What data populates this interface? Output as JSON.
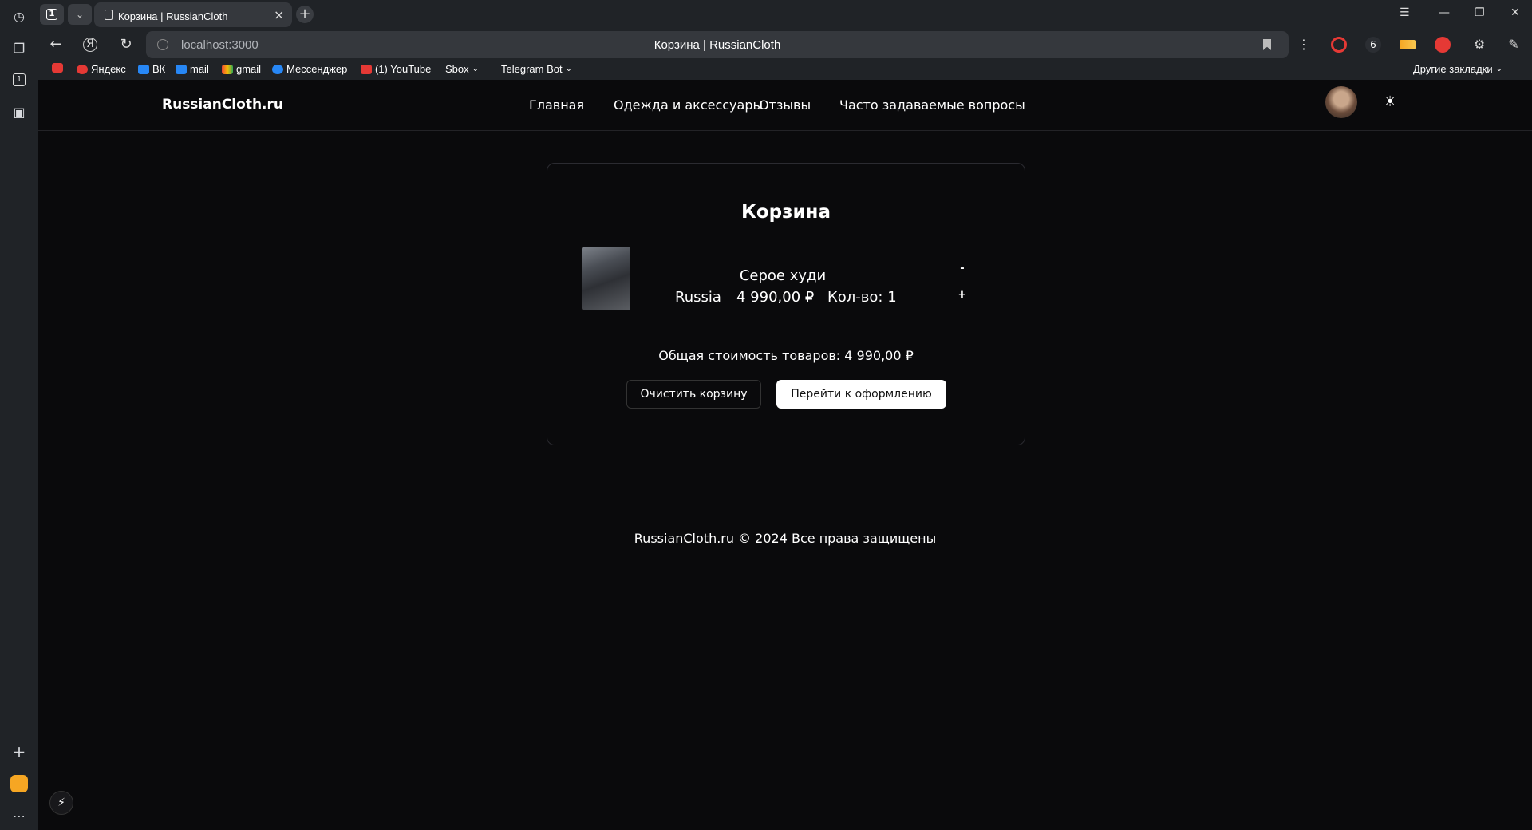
{
  "browser": {
    "tab_count": "1",
    "tab_title": "Корзина | RussianCloth",
    "url": "localhost:3000",
    "page_title": "Корзина | RussianCloth",
    "bookmarks": [
      "Яндекс",
      "ВК",
      "mail",
      "gmail",
      "Мессенджер",
      "(1) YouTube",
      "Sbox",
      "Telegram Bot"
    ],
    "other_bookmarks": "Другие закладки",
    "ext_badge": "6"
  },
  "site": {
    "logo": "RussianCloth.ru",
    "nav": [
      "Главная",
      "Одежда и аксессуары",
      "Отзывы",
      "Часто задаваемые вопросы"
    ]
  },
  "cart": {
    "title": "Корзина",
    "item": {
      "name": "Серое худи",
      "country": "Russia",
      "price": "4 990,00 ₽",
      "qty_text": "Кол-во: 1",
      "minus": "-",
      "plus": "+"
    },
    "total": "Общая стоимость товаров: 4 990,00 ₽",
    "clear_label": "Очистить корзину",
    "checkout_label": "Перейти к оформлению"
  },
  "footer": {
    "text": "RussianCloth.ru © 2024 Все права защищены"
  }
}
